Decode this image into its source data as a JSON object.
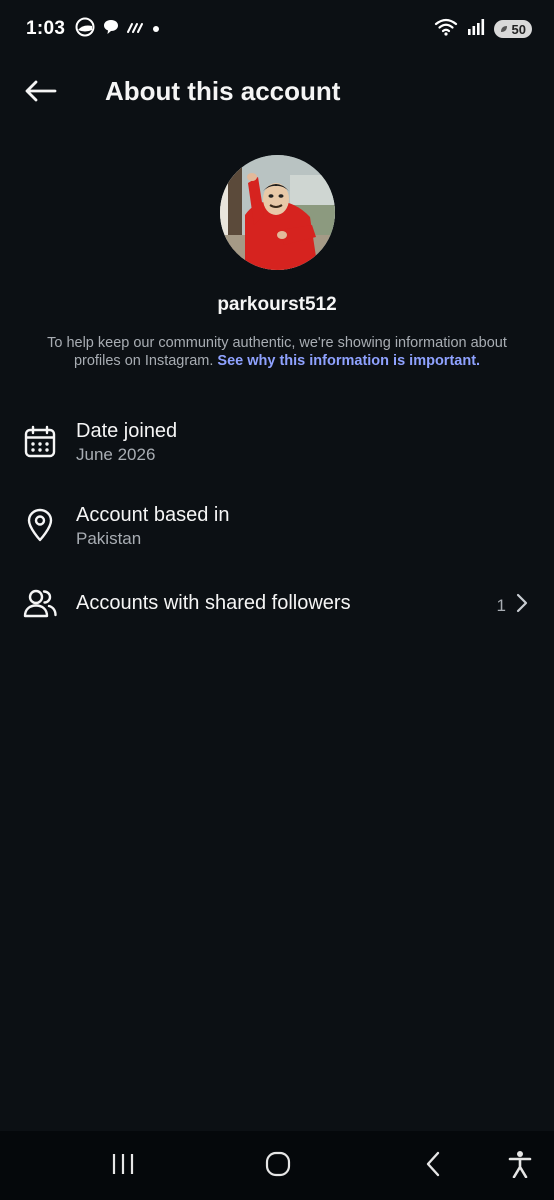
{
  "status_bar": {
    "time": "1:03",
    "battery": "50",
    "icons": [
      "browser-icon",
      "chat-bubble-icon",
      "signal-bars-icon",
      "notification-dot-icon",
      "wifi-icon",
      "cellular-signal-icon",
      "battery-icon"
    ]
  },
  "header": {
    "title": "About this account",
    "back_icon": "arrow-left-icon"
  },
  "profile": {
    "username": "parkourst512",
    "info_text": "To help keep our community authentic, we're showing information about profiles on Instagram.",
    "info_link": "See why this information is important."
  },
  "rows": [
    {
      "icon": "calendar-icon",
      "title": "Date joined",
      "subtitle": "June 2026"
    },
    {
      "icon": "location-pin-icon",
      "title": "Account based in",
      "subtitle": "Pakistan"
    },
    {
      "icon": "people-icon",
      "title": "Accounts with shared followers",
      "count": "1",
      "chevron": "chevron-right-icon"
    }
  ],
  "nav_bar": {
    "buttons": [
      "recent-apps-icon",
      "home-icon",
      "back-icon",
      "accessibility-icon"
    ]
  },
  "colors": {
    "background": "#0c1014",
    "text_primary": "#f5f5f5",
    "text_secondary": "#a8adb3",
    "link": "#8fa2ff"
  }
}
